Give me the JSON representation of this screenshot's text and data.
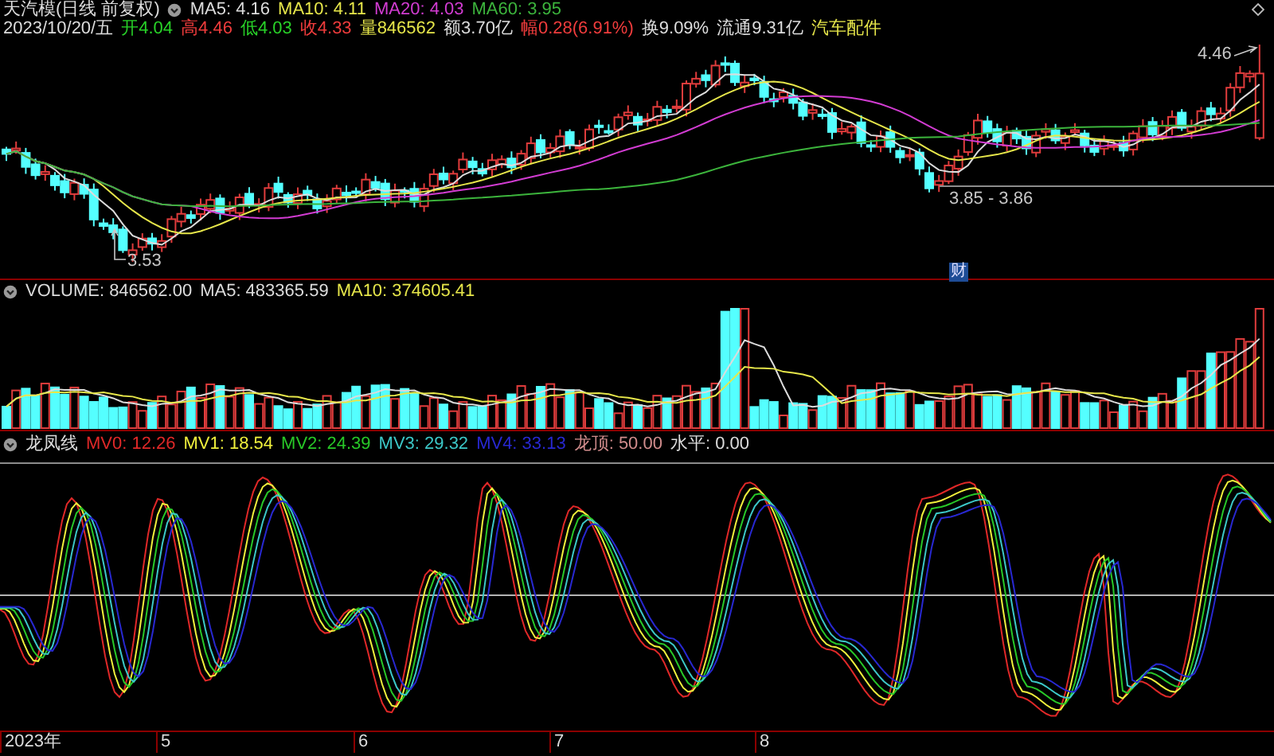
{
  "header": {
    "title": "天汽模(日线 前复权)",
    "indicators": [
      {
        "text": "MA5: 4.16",
        "color": "#dcdcdc"
      },
      {
        "text": "MA10: 4.11",
        "color": "#e6e64a"
      },
      {
        "text": "MA20: 4.03",
        "color": "#d23cd2"
      },
      {
        "text": "MA60: 3.95",
        "color": "#3cb43c"
      }
    ]
  },
  "quote": [
    {
      "text": "2023/10/20/五",
      "color": "#dcdcdc"
    },
    {
      "text": "开4.04",
      "color": "#28d228"
    },
    {
      "text": "高4.46",
      "color": "#f03c3c"
    },
    {
      "text": "低4.03",
      "color": "#28d228"
    },
    {
      "text": "收4.33",
      "color": "#f03c3c"
    },
    {
      "text": "量846562",
      "color": "#e6e64a"
    },
    {
      "text": "额3.70亿",
      "color": "#dcdcdc"
    },
    {
      "text": "幅0.28(6.91%)",
      "color": "#f03c3c"
    },
    {
      "text": "换9.09%",
      "color": "#dcdcdc"
    },
    {
      "text": "流通9.31亿",
      "color": "#dcdcdc"
    },
    {
      "text": "汽车配件",
      "color": "#e6e64a"
    }
  ],
  "price_chart": {
    "annotations": [
      {
        "kind": "high",
        "text": "4.46"
      },
      {
        "kind": "low",
        "text": "3.53"
      },
      {
        "kind": "range",
        "text": "3.85 - 3.86"
      }
    ],
    "badge": "财"
  },
  "volume": {
    "indicators": [
      {
        "text": "VOLUME: 846562.00",
        "color": "#dcdcdc"
      },
      {
        "text": "MA5: 483365.59",
        "color": "#dcdcdc"
      },
      {
        "text": "MA10: 374605.41",
        "color": "#e6e64a"
      }
    ]
  },
  "oscillator": {
    "title": "龙凤线",
    "indicators": [
      {
        "text": "MV0: 12.26",
        "color": "#e02828"
      },
      {
        "text": "MV1: 18.54",
        "color": "#f0f03c"
      },
      {
        "text": "MV2: 24.39",
        "color": "#28c828"
      },
      {
        "text": "MV3: 29.32",
        "color": "#3cc8c8"
      },
      {
        "text": "MV4: 33.13",
        "color": "#2828d2"
      },
      {
        "text": "龙顶: 50.00",
        "color": "#d08c8c"
      },
      {
        "text": "水平: 0.00",
        "color": "#dcdcdc"
      }
    ]
  },
  "x_axis": {
    "labels": [
      "2023年",
      "5",
      "6",
      "7",
      "8"
    ]
  }
}
